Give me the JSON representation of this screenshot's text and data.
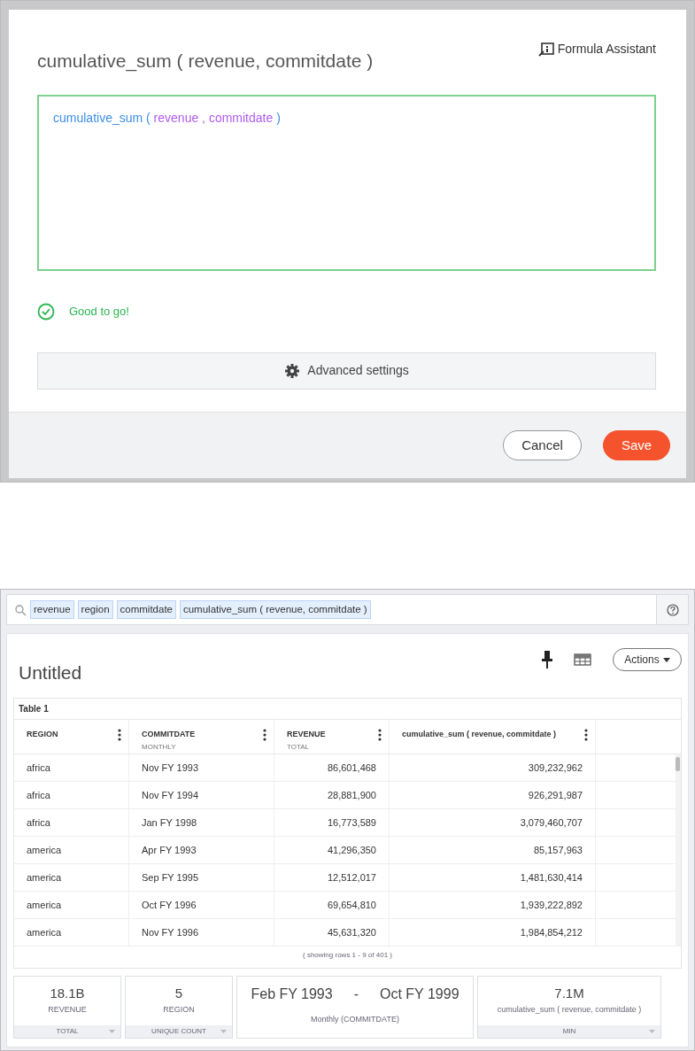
{
  "dialog": {
    "title": "cumulative_sum ( revenue, commitdate )",
    "assistant_link": "Formula Assistant",
    "formula": [
      {
        "text": "cumulative_sum",
        "kind": "function"
      },
      {
        "text": "(",
        "kind": "punct"
      },
      {
        "text": "revenue",
        "kind": "column"
      },
      {
        "text": ",",
        "kind": "column"
      },
      {
        "text": "commitdate",
        "kind": "column"
      },
      {
        "text": ")",
        "kind": "punct"
      }
    ],
    "status": {
      "text": "Good to go!",
      "valid": true
    },
    "advanced": "Advanced settings",
    "buttons": [
      {
        "label": "Cancel",
        "kind": "secondary"
      },
      {
        "label": "Save",
        "kind": "primary"
      }
    ]
  },
  "search": {
    "tokens": [
      "revenue",
      "region",
      "commitdate",
      "cumulative_sum ( revenue, commitdate )"
    ]
  },
  "answer": {
    "title": "Untitled",
    "actions": "Actions"
  },
  "table": {
    "title": "Table 1",
    "columns": [
      {
        "label": "REGION",
        "kind": "text"
      },
      {
        "label": "COMMITDATE",
        "sub": "MONTHLY",
        "kind": "text"
      },
      {
        "label": "REVENUE",
        "sub": "TOTAL",
        "kind": "number"
      },
      {
        "label": "cumulative_sum ( revenue, commitdate )",
        "kind": "number"
      }
    ],
    "rows": [
      [
        "africa",
        "Nov FY 1993",
        "86,601,468",
        "309,232,962"
      ],
      [
        "africa",
        "Nov FY 1994",
        "28,881,900",
        "926,291,987"
      ],
      [
        "africa",
        "Jan FY 1998",
        "16,773,589",
        "3,079,460,707"
      ],
      [
        "america",
        "Apr FY 1993",
        "41,296,350",
        "85,157,963"
      ],
      [
        "america",
        "Sep FY 1995",
        "12,512,017",
        "1,481,630,414"
      ],
      [
        "america",
        "Oct FY 1996",
        "69,654,810",
        "1,939,222,892"
      ],
      [
        "america",
        "Nov FY 1996",
        "45,631,320",
        "1,984,854,212"
      ]
    ],
    "footer": "( showing rows 1 - 9 of 401 )"
  },
  "summaries": [
    {
      "kind": "metric",
      "value": "18.1B",
      "label": "REVENUE",
      "footer": "TOTAL"
    },
    {
      "kind": "metric",
      "value": "5",
      "label": "REGION",
      "footer": "UNIQUE COUNT"
    },
    {
      "kind": "range",
      "from": "Feb FY 1993",
      "separator": "-",
      "to": "Oct FY 1999",
      "label": "Monthly (COMMITDATE)"
    },
    {
      "kind": "metric",
      "value": "7.1M",
      "label": "cumulative_sum ( revenue, commitdate )",
      "footer": "MIN"
    }
  ]
}
